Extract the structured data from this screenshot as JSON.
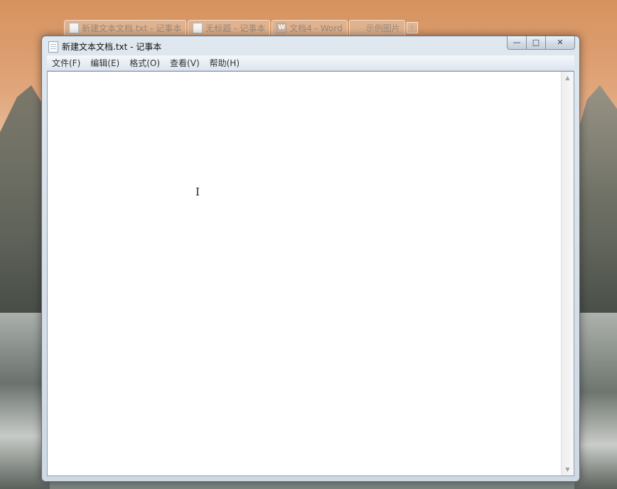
{
  "taskbar_tabs": [
    {
      "label": "新建文本文档.txt - 记事本",
      "icon": "notepad-icon"
    },
    {
      "label": "无标题 - 记事本",
      "icon": "notepad-icon"
    },
    {
      "label": "文档4 - Word",
      "icon": "word-icon",
      "icon_text": "W"
    },
    {
      "label": "示例图片",
      "icon": "picture-icon"
    }
  ],
  "add_tab_symbol": "+",
  "window": {
    "title": "新建文本文档.txt - 记事本",
    "buttons": {
      "minimize": "—",
      "maximize": "□",
      "close": "✕"
    }
  },
  "menu": [
    {
      "label": "文件(F)"
    },
    {
      "label": "编辑(E)"
    },
    {
      "label": "格式(O)"
    },
    {
      "label": "查看(V)"
    },
    {
      "label": "帮助(H)"
    }
  ],
  "editor": {
    "content": "",
    "cursor_glyph": "I",
    "scroll_up": "▲",
    "scroll_down": "▼"
  }
}
